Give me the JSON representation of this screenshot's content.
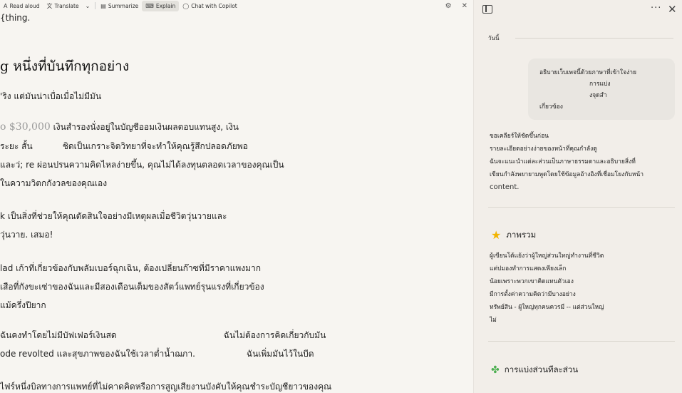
{
  "toolbar": {
    "read_aloud": "Read aloud",
    "translate": "Translate",
    "summarize": "Summarize",
    "explain": "Explain",
    "chat": "Chat with Copilot"
  },
  "article": {
    "lines": [
      "{thing.",
      "g หนึ่งที่บันทึกทุกอย่าง",
      "'ริง แต่มันน่าเบื่อเมื่อไม่มีมัน",
      "เงินสำรองนั่งอยู่ในบัญชีออมเงินผลตอบแทนสูง, เงิน",
      "ระยะ สั้น",
      "ชิดเป็นเกราะจิตวิทยาที่จะทำให้คุณรู้สึกปลอดภัยพอ",
      "และว่; re ผ่อนปรนความคิดไหลง่ายขึ้น, คุณไม่ได้ลงทุนตลอดเวลาของคุณเป็น",
      "ในความวิตกกังวลของคุณเอง",
      "k เป็นสิ่งที่ช่วยให้คุณตัดสินใจอย่างมีเหตุผลเมื่อชีวิตวุ่นวายและ",
      "วุ่นวาย. เสมอ!",
      "lad เก้าที่เกี่ยวข้องกับพลัมเบอร์ฉุกเฉิน, ต้องเปลี่ยนก๊าซที่มีราคาแพงมาก",
      "เสือที่กังขะเซ่าของฉันและมีสองเดือนเต็มของสัตว์แพทย์รุนแรงที่เกี่ยวข้อง",
      "แม้ครึ่งปียาก",
      "ฉันคงทำโดยไม่มีบัฟเฟอร์เงินสด",
      "ฉันไม่ต้องการคิดเกี่ยวกับมัน",
      "ode revolted และสุขภาพของฉันใช้เวลาต่ำน้ำฌภา.",
      "ฉันเพิ่มมันไว้ในบีด",
      "ไฟร์หนึ่งบิลทางการแพทย์ที่ไม่คาดคิดหรือการสูญเสียงานบังคับให้คุณชำระบัญชียาวของคุณ"
    ],
    "money": "о $30,000"
  },
  "panel": {
    "today": "วันนี้",
    "user_message": [
      "อธิบายเว็บเพจนี้ด้วยภาษาที่เข้าใจง่าย",
      "การแบ่ง",
      "งจุดสำ",
      "เกี่ยวข้อง"
    ],
    "reply": [
      "ขอเคลียร์ให้ชัดขึ้นก่อน",
      "รายละเอียดอย่างง่ายของหน้าที่คุณกำลังดู",
      "ฉันจะแนะนำแต่ละส่วนเป็นภาษาธรรมดาและอธิบายสิ่งที่",
      "เขียนกำลังพยายามพูดโดยใช้ข้อมูลอ้างอิงที่เชื่อมโยงกับหน้า",
      "content."
    ],
    "overview_title": "ภาพรวม",
    "overview": [
      "ผู้เขียนโต้แย้งว่าผู้ใหญ่ส่วนใหญ่ทำงานที่ชีวิต",
      "แต่ปมองทำการแสดงเพียงเล็ก",
      "น้อยเพราะพวกเขาคิดแทนตัวเอง",
      "มีการตั้งค่าความคิดว่ามีบางอย่าง",
      "ทรัพย์สิน - ผู้ใหญ่ทุกคนควรมี -- แต่ส่วนใหญ่",
      "ไม่"
    ],
    "sections_title": "การแบ่งส่วนทีละส่วน"
  }
}
